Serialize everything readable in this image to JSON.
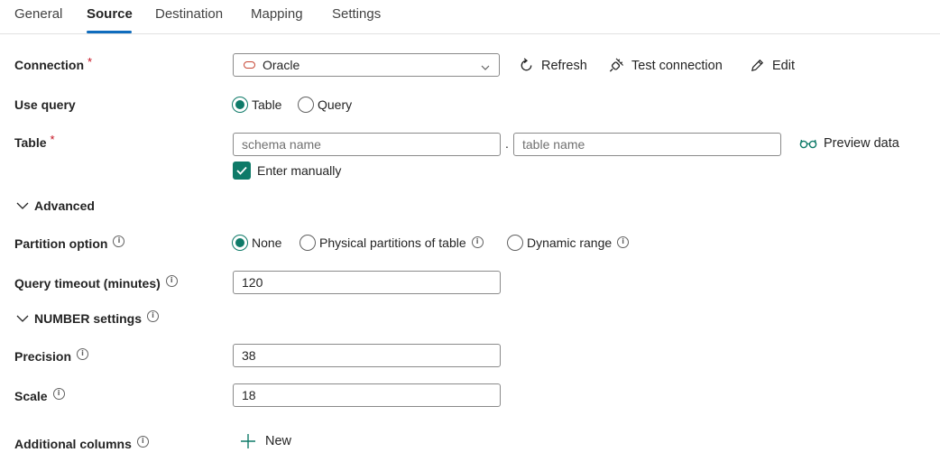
{
  "tabs": [
    {
      "label": "General"
    },
    {
      "label": "Source"
    },
    {
      "label": "Destination"
    },
    {
      "label": "Mapping"
    },
    {
      "label": "Settings"
    }
  ],
  "active_tab": "Source",
  "connection": {
    "label": "Connection",
    "required_mark": "*",
    "value": "Oracle",
    "refresh_label": "Refresh",
    "test_label": "Test connection",
    "edit_label": "Edit"
  },
  "use_query": {
    "label": "Use query",
    "options": [
      "Table",
      "Query"
    ],
    "selected": "Table"
  },
  "table": {
    "label": "Table",
    "required_mark": "*",
    "schema_placeholder": "schema name",
    "separator": ".",
    "table_placeholder": "table name",
    "preview_label": "Preview data",
    "enter_manually_label": "Enter manually",
    "enter_manually_checked": true
  },
  "advanced": {
    "label": "Advanced",
    "expanded": true
  },
  "partition": {
    "label": "Partition option",
    "options": [
      "None",
      "Physical partitions of table",
      "Dynamic range"
    ],
    "selected": "None"
  },
  "query_timeout": {
    "label": "Query timeout (minutes)",
    "value": "120"
  },
  "number_settings": {
    "label": "NUMBER settings",
    "expanded": true
  },
  "precision": {
    "label": "Precision",
    "value": "38"
  },
  "scale": {
    "label": "Scale",
    "value": "18"
  },
  "additional_columns": {
    "label": "Additional columns",
    "new_label": "New"
  },
  "colors": {
    "accent": "#0e7a68",
    "tab_underline": "#0f6cbd",
    "required": "#c50f1f",
    "oracle_icon": "#c74634"
  }
}
